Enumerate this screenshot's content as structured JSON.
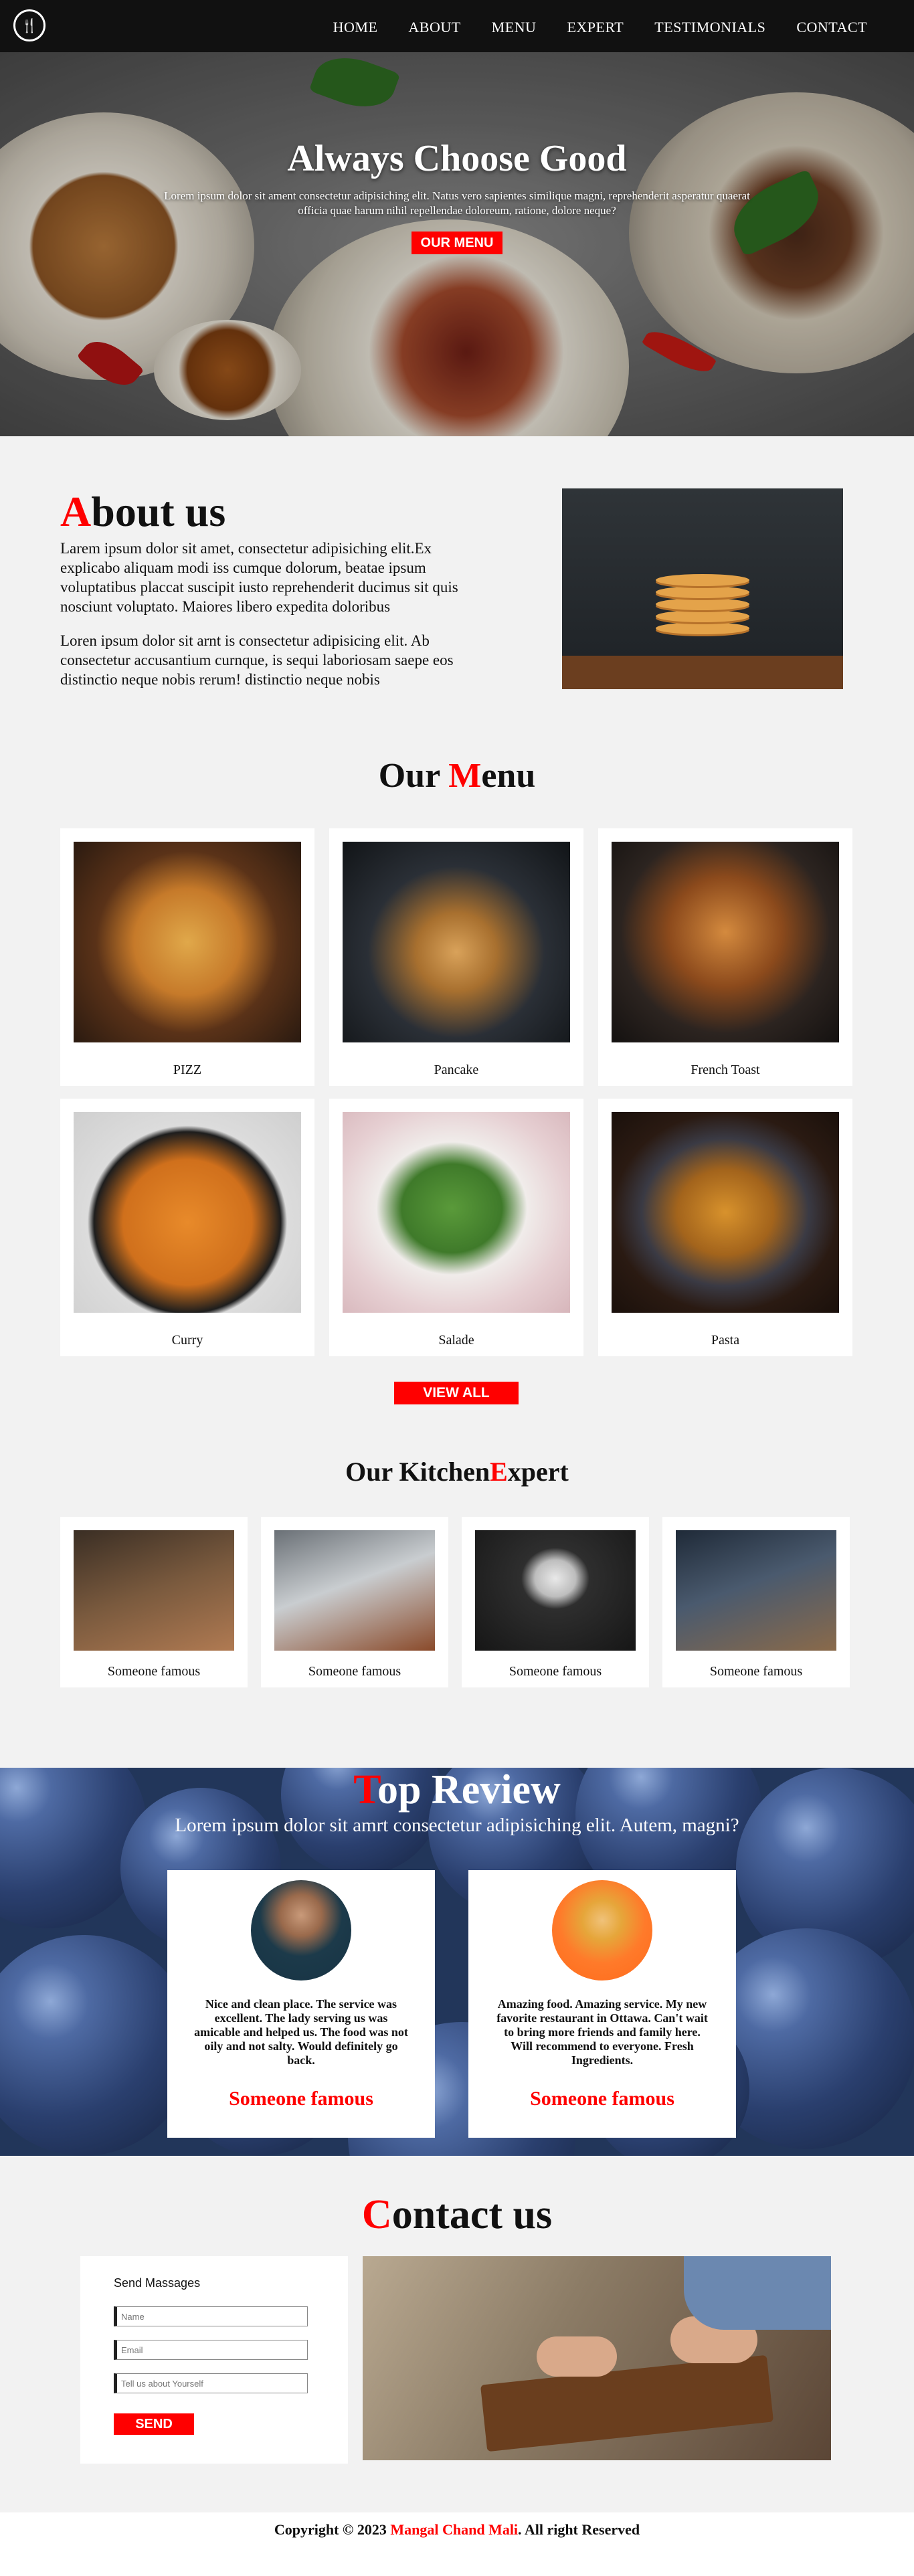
{
  "nav": {
    "logo_icon": "restaurant-utensils-icon",
    "items": [
      "HOME",
      "ABOUT",
      "MENU",
      "EXPERT",
      "TESTIMONIALS",
      "CONTACT"
    ]
  },
  "hero": {
    "title": "Always Choose Good",
    "subtitle": "Lorem ipsum dolor sit ament consectetur adipisiching elit. Natus vero sapientes similique magni, reprehenderit asperatur quaerat officia quae harum nihil repellendae doloreum, ratione, dolore neque?",
    "button": "OUR MENU"
  },
  "about": {
    "title_first": "A",
    "title_rest": "bout us",
    "p1": "Larem ipsum dolor sit amet, consectetur adipisiching elit.Ex explicabo aliquam modi iss cumque dolorum, beatae ipsum voluptatibus placcat suscipit iusto reprehenderit ducimus sit quis nosciunt voluptato. Maiores libero expedita doloribus",
    "p2": "Loren ipsum dolor sit arnt is consectetur adipisicing elit. Ab consectetur accusantium curnque, is sequi laboriosam saepe eos distinctio neque nobis rerum! distinctio neque nobis"
  },
  "menu": {
    "title_a": "Our ",
    "title_b": "M",
    "title_c": "enu",
    "items": [
      {
        "label": "PIZZ"
      },
      {
        "label": "Pancake"
      },
      {
        "label": "French Toast"
      },
      {
        "label": "Curry"
      },
      {
        "label": "Salade"
      },
      {
        "label": "Pasta"
      }
    ],
    "view_all": "VIEW ALL"
  },
  "experts": {
    "title_a": "Our Kitchen",
    "title_b": "E",
    "title_c": "xpert",
    "items": [
      {
        "label": "Someone famous"
      },
      {
        "label": "Someone famous"
      },
      {
        "label": "Someone famous"
      },
      {
        "label": "Someone famous"
      }
    ]
  },
  "review": {
    "title_first": "T",
    "title_rest": "op Review",
    "subtitle": "Lorem ipsum dolor sit amrt consectetur adipisiching elit. Autem, magni?",
    "cards": [
      {
        "text": "Nice and clean place. The service was excellent. The lady serving us was amicable and helped us. The food was not oily and not salty. Would definitely go back.",
        "name": "Someone famous"
      },
      {
        "text": "Amazing food. Amazing service. My new favorite restaurant in Ottawa. Can't wait to bring more friends and family here. Will recommend to everyone. Fresh Ingredients.",
        "name": "Someone famous"
      }
    ]
  },
  "contact": {
    "title_first": "C",
    "title_rest": "ontact us",
    "form_label": "Send Massages",
    "name_placeholder": "Name",
    "email_placeholder": "Email",
    "message_placeholder": "Tell us about Yourself",
    "send": "SEND"
  },
  "footer": {
    "prefix": "Copyright © 2023 ",
    "author": "Mangal Chand Mali",
    "suffix": ". All right Reserved"
  },
  "colors": {
    "accent": "#ff0000",
    "header_bg": "#111111",
    "page_bg": "#f2f2f2"
  }
}
